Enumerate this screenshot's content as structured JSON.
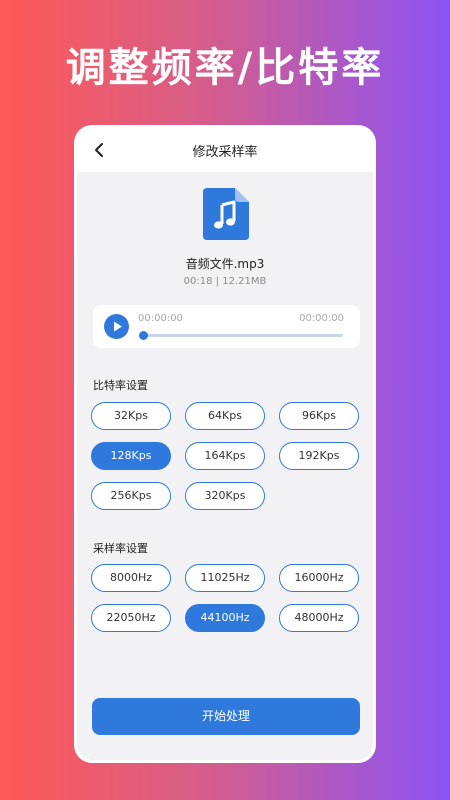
{
  "headline": "调整频率/比特率",
  "navbar": {
    "title": "修改采样率",
    "back_icon": "chevron-left-icon"
  },
  "file": {
    "icon": "music-file-icon",
    "name": "音频文件.mp3",
    "meta": "00:18 | 12.21MB"
  },
  "player": {
    "play_icon": "play-icon",
    "current_time": "00:00:00",
    "total_time": "00:00:00",
    "progress": 0
  },
  "bitrate": {
    "title": "比特率设置",
    "options": [
      "32Kps",
      "64Kps",
      "96Kps",
      "128Kps",
      "164Kps",
      "192Kps",
      "256Kps",
      "320Kps"
    ],
    "selected": "128Kps"
  },
  "samplerate": {
    "title": "采样率设置",
    "options": [
      "8000Hz",
      "11025Hz",
      "16000Hz",
      "22050Hz",
      "44100Hz",
      "48000Hz"
    ],
    "selected": "44100Hz"
  },
  "start_button": "开始处理",
  "colors": {
    "accent": "#2f79dc",
    "background_gradient": [
      "#ff5a56",
      "#8b54f6"
    ],
    "screen_bg": "#f2f2f4"
  }
}
